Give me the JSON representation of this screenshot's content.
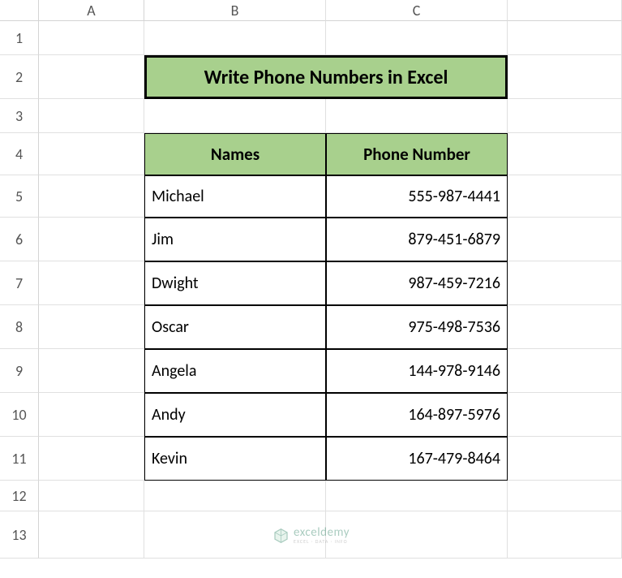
{
  "columns": [
    "A",
    "B",
    "C"
  ],
  "rows": [
    "1",
    "2",
    "3",
    "4",
    "5",
    "6",
    "7",
    "8",
    "9",
    "10",
    "11",
    "12",
    "13"
  ],
  "title": "Write Phone Numbers in Excel",
  "headers": {
    "name": "Names",
    "phone": "Phone Number"
  },
  "data": [
    {
      "name": "Michael",
      "phone": "555-987-4441"
    },
    {
      "name": "Jim",
      "phone": "879-451-6879"
    },
    {
      "name": "Dwight",
      "phone": "987-459-7216"
    },
    {
      "name": "Oscar",
      "phone": "975-498-7536"
    },
    {
      "name": "Angela",
      "phone": "144-978-9146"
    },
    {
      "name": "Andy",
      "phone": "164-897-5976"
    },
    {
      "name": "Kevin",
      "phone": "167-479-8464"
    }
  ],
  "watermark": {
    "title": "exceldemy",
    "sub": "EXCEL · DATA · INFO"
  }
}
